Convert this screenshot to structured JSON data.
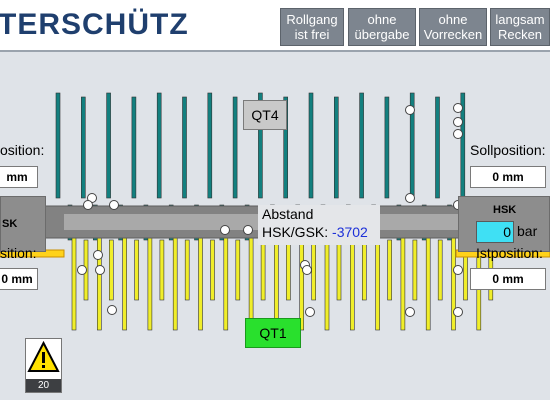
{
  "header": {
    "brand": "TERSCHÜTZ",
    "buttons": [
      {
        "line1": "Rollgang",
        "line2": "ist frei"
      },
      {
        "line1": "ohne",
        "line2": "übergabe"
      },
      {
        "line1": "ohne",
        "line2": "Vorrecken"
      },
      {
        "line1": "langsam",
        "line2": "Recken"
      }
    ]
  },
  "left": {
    "soll_label": "osition:",
    "soll_value": "mm",
    "hsk_label": "SK",
    "ist_label": "sition:",
    "ist_value": "0 mm"
  },
  "right": {
    "soll_label": "Sollposition:",
    "soll_value": "0 mm",
    "hsk_label": "HSK",
    "pressure_value": "0",
    "pressure_unit": "bar",
    "ist_label": "Istposition:",
    "ist_value": "0 mm"
  },
  "center": {
    "qt4_label": "QT4",
    "qt1_label": "QT1",
    "abstand_line1": "Abstand",
    "abstand_line2": "HSK/GSK:",
    "abstand_value": "-3702"
  },
  "warning": {
    "icon": "warning-triangle-icon",
    "count": "20"
  },
  "colors": {
    "brand": "#1f3f6e",
    "teal_rod": "#13807f",
    "yellow_rod": "#f0ee2a",
    "qt1": "#29e02d",
    "pressure_field": "#3fe0f4",
    "abstand_value": "#1c30d8"
  }
}
